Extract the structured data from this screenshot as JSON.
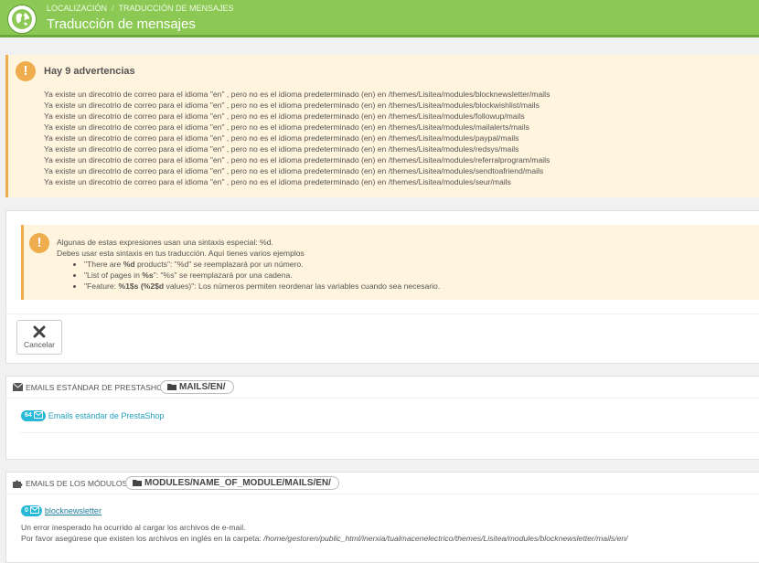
{
  "header": {
    "breadcrumb": [
      "LOCALIZACIÓN",
      "TRADUCCIÓN DE MENSAJES"
    ],
    "breadcrumb_sep": "/",
    "title": "Traducción de mensajes",
    "logo_icon": "globe-icon"
  },
  "warnings": {
    "title": "Hay 9 advertencias",
    "icon": "exclamation-icon",
    "items": [
      "Ya existe un direcotrio de correo para el idioma \"en\" , pero no es el idioma predeterminado (en) en /themes/Lisitea/modules/blocknewsletter/mails",
      "Ya existe un direcotrio de correo para el idioma \"en\" , pero no es el idioma predeterminado (en) en /themes/Lisitea/modules/blockwishlist/mails",
      "Ya existe un direcotrio de correo para el idioma \"en\" , pero no es el idioma predeterminado (en) en /themes/Lisitea/modules/followup/mails",
      "Ya existe un direcotrio de correo para el idioma \"en\" , pero no es el idioma predeterminado (en) en /themes/Lisitea/modules/mailalerts/mails",
      "Ya existe un direcotrio de correo para el idioma \"en\" , pero no es el idioma predeterminado (en) en /themes/Lisitea/modules/paypal/mails",
      "Ya existe un direcotrio de correo para el idioma \"en\" , pero no es el idioma predeterminado (en) en /themes/Lisitea/modules/redsys/mails",
      "Ya existe un direcotrio de correo para el idioma \"en\" , pero no es el idioma predeterminado (en) en /themes/Lisitea/modules/referralprogram/mails",
      "Ya existe un direcotrio de correo para el idioma \"en\" , pero no es el idioma predeterminado (en) en /themes/Lisitea/modules/sendtoafriend/mails",
      "Ya existe un direcotrio de correo para el idioma \"en\" , pero no es el idioma predeterminado (en) en /themes/Lisitea/modules/seur/mails"
    ]
  },
  "info": {
    "line1": "Algunas de estas expresiones usan una sintaxis especial: %d.",
    "line2": "Debes usar esta sintaxis en tus traducción. Aquí tienes varios ejemplos",
    "examples": [
      {
        "pre": "\"There are ",
        "bold": "%d",
        "post": " products\": \"%d\" se reemplazará por un número."
      },
      {
        "pre": "\"List of pages in ",
        "bold": "%s",
        "post": "\": \"%s\" se reemplazará por una cadena."
      },
      {
        "pre": "\"Feature: ",
        "bold": "%1$s (%2$d",
        "post": " values)\": Los números permiten reordenar las variables cuando sea necesario."
      }
    ]
  },
  "actions": {
    "cancel_label": "Cancelar",
    "cancel_icon": "close-icon"
  },
  "std_emails": {
    "heading": "EMAILS ESTÁNDAR DE PRESTASHOP",
    "heading_icon": "envelope-icon",
    "path": "MAILS/EN/",
    "path_icon": "folder-icon",
    "count": "64",
    "link": "Emails estándar de PrestaShop"
  },
  "module_emails": {
    "heading": "EMAILS DE LOS MÓDULOS",
    "heading_icon": "puzzle-icon",
    "path": "MODULES/NAME_OF_MODULE/MAILS/EN/",
    "path_icon": "folder-icon",
    "count": "0",
    "link": "blocknewsletter",
    "error_line1": "Un error inesperado ha ocurrido al cargar los archivos de e-mail.",
    "error_line2": "Por favor asegúrese que existen los archivos en inglés en la carpeta: ",
    "error_path": "/home/gestoren/public_html/inerxia/tualmacenelectrico/themes/Lisitea/modules/blocknewsletter/mails/en/"
  },
  "colors": {
    "header_green": "#8bc954",
    "warning_orange": "#f0ad4e",
    "warning_bg": "#fff4dd",
    "link_blue": "#25a2c0",
    "badge_blue": "#25b9d7"
  }
}
